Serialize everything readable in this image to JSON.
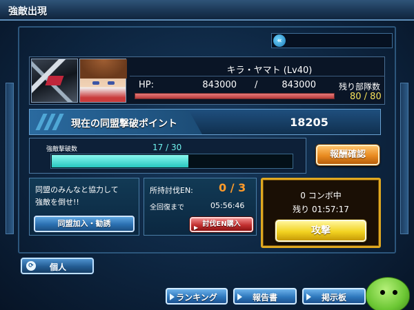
{
  "window": {
    "title": "強敵出現"
  },
  "boss": {
    "name": "キラ・ヤマト (Lv40)",
    "hp_label": "HP:",
    "hp_current": "843000",
    "hp_separator": "/",
    "hp_max": "843000",
    "hp_fraction": 1.0,
    "units_label": "残り部隊数",
    "units_value": "80 / 80"
  },
  "points": {
    "label": "現在の同盟撃破ポイント",
    "value": "18205"
  },
  "kills": {
    "label": "強敵撃破数",
    "value": "17 / 30",
    "progress": 0.567
  },
  "reward_button": "報酬確認",
  "alliance": {
    "message_line1": "同盟のみんなと協力して",
    "message_line2": "強敵を倒せ!!",
    "join_button": "同盟加入・勧誘"
  },
  "energy": {
    "label": "所持討伐EN:",
    "value": "0 / 3",
    "recover_label": "全回復まで",
    "recover_time": "05:56:46",
    "buy_button": "討伐EN購入"
  },
  "combo": {
    "status": "0 コンボ中",
    "remaining": "残り 01:57:17",
    "attack_button": "攻撃"
  },
  "personal_button": "個人",
  "nav": {
    "ranking": "ランキング",
    "report": "報告書",
    "board": "掲示板"
  },
  "colors": {
    "kill_bar": "#27c6be",
    "units_value": "#f5e15a",
    "en_value": "#ff9b2b",
    "attack_button": "#f2d321",
    "hp_bar": "#b53a3a"
  }
}
